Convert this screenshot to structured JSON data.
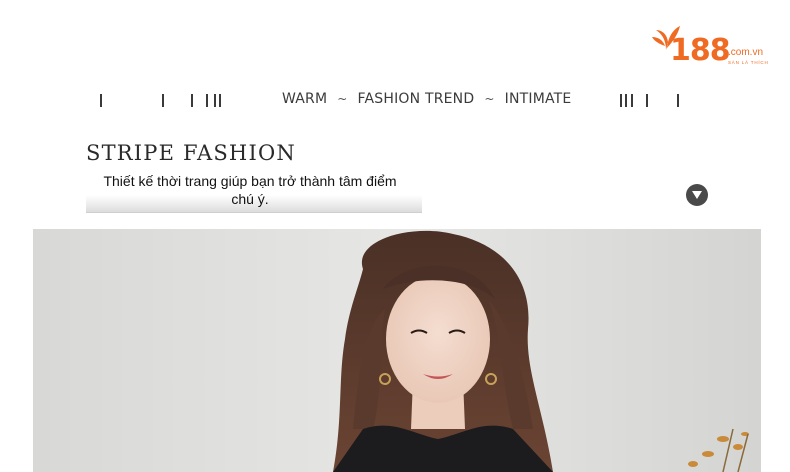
{
  "logo": {
    "number": "188",
    "domain": ".com.vn",
    "tagline": "SÀN LÀ THÍCH"
  },
  "header": {
    "word1": "WARM",
    "sep": "~",
    "word2": "FASHION TREND",
    "word3": "INTIMATE"
  },
  "hero": {
    "title": "STRIPE FASHION",
    "subtitle": "Thiết kế thời trang giúp bạn trở thành tâm điểm chú ý."
  },
  "icons": {
    "expand": "chevron-down-circle-icon"
  },
  "colors": {
    "brand": "#ef6a23",
    "text": "#3b3b3b",
    "background": "#ffffff"
  }
}
